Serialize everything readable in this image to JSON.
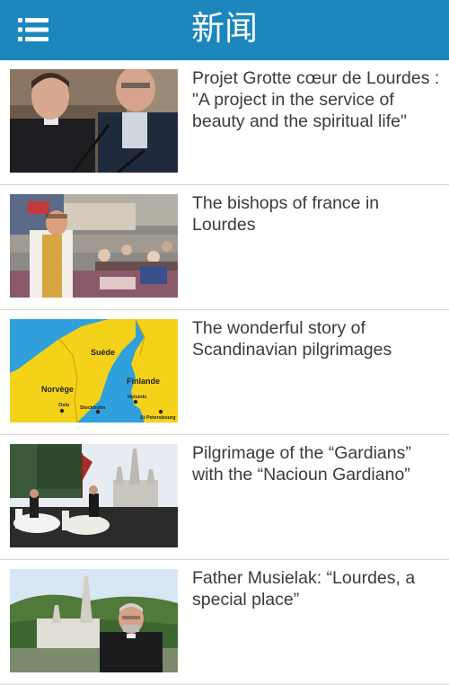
{
  "header": {
    "title": "新闻",
    "menu_icon": "hamburger-menu-icon",
    "color": "#1b87bd"
  },
  "news": [
    {
      "title": "Projet Grotte cœur de Lourdes : \"A project in the service of beauty and the spiritual life\"",
      "image": "two-clergymen-at-microphones"
    },
    {
      "title": "The bishops of france in Lourdes",
      "image": "bishop-blessing-crowd"
    },
    {
      "title": "The wonderful story of Scandinavian pilgrimages",
      "image": "scandinavia-map"
    },
    {
      "title": "Pilgrimage of the “Gardians” with the “Nacioun Gardiano”",
      "image": "horse-riders-before-basilica"
    },
    {
      "title": "Father Musielak: “Lourdes, a special place”",
      "image": "priest-before-basilica"
    }
  ],
  "map_labels": {
    "sweden": "Suède",
    "norway": "Norvège",
    "finland": "Finlande",
    "oslo": "Oslo",
    "stockholm": "Stockholm",
    "helsinki": "Helsinki",
    "st_petersburg": "St Petersbourg"
  }
}
